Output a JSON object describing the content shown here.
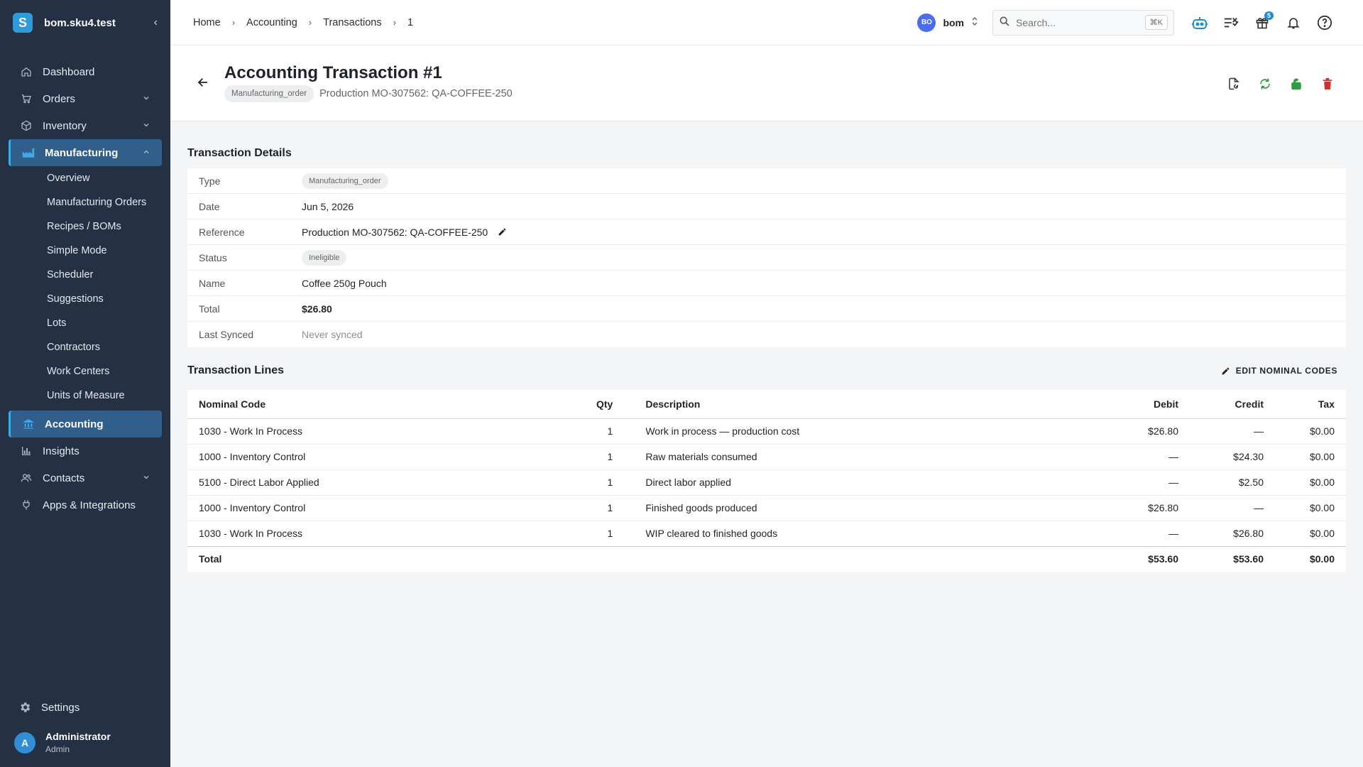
{
  "sidebar": {
    "brand_initial": "S",
    "brand_name": "bom.sku4.test",
    "collapse_glyph": "‹",
    "items": [
      {
        "label": "Dashboard",
        "icon": "home-icon"
      },
      {
        "label": "Orders",
        "icon": "cart-icon"
      },
      {
        "label": "Inventory",
        "icon": "box-icon"
      },
      {
        "label": "Manufacturing",
        "icon": "factory-icon"
      }
    ],
    "manufacturing_sub": [
      "Overview",
      "Manufacturing Orders",
      "Recipes / BOMs",
      "Simple Mode",
      "Scheduler",
      "Suggestions",
      "Lots",
      "Contractors",
      "Work Centers",
      "Units of Measure"
    ],
    "items_after": [
      {
        "label": "Accounting",
        "icon": "bank-icon"
      },
      {
        "label": "Insights",
        "icon": "chart-icon"
      },
      {
        "label": "Contacts",
        "icon": "people-icon"
      },
      {
        "label": "Apps & Integrations",
        "icon": "plug-icon"
      }
    ],
    "settings_label": "Settings",
    "user": {
      "initial": "A",
      "name": "Administrator",
      "role": "Admin"
    }
  },
  "topbar": {
    "breadcrumbs": [
      "Home",
      "Accounting",
      "Transactions",
      "1"
    ],
    "org_badge": "BO",
    "org_name": "bom",
    "search_placeholder": "Search...",
    "search_shortcut": "⌘K",
    "gift_count": "5"
  },
  "header": {
    "title": "Accounting Transaction #1",
    "type_chip": "Manufacturing_order",
    "reference": "Production MO-307562: QA-COFFEE-250"
  },
  "details": {
    "section_title": "Transaction Details",
    "rows": {
      "type": {
        "label": "Type",
        "value": "Manufacturing_order"
      },
      "date": {
        "label": "Date",
        "value": "Jun 5, 2026"
      },
      "reference": {
        "label": "Reference",
        "value": "Production MO-307562: QA-COFFEE-250"
      },
      "status": {
        "label": "Status",
        "value": "Ineligible"
      },
      "name": {
        "label": "Name",
        "value": "Coffee 250g Pouch"
      },
      "total": {
        "label": "Total",
        "value": "$26.80"
      },
      "last_synced": {
        "label": "Last Synced",
        "value": "Never synced"
      }
    }
  },
  "lines": {
    "section_title": "Transaction Lines",
    "edit_label": "EDIT NOMINAL CODES",
    "columns": {
      "code": "Nominal Code",
      "qty": "Qty",
      "desc": "Description",
      "debit": "Debit",
      "credit": "Credit",
      "tax": "Tax"
    },
    "rows": [
      {
        "code": "1030 - Work In Process",
        "qty": "1",
        "desc": "Work in process — production cost",
        "debit": "$26.80",
        "credit": "—",
        "tax": "$0.00"
      },
      {
        "code": "1000 - Inventory Control",
        "qty": "1",
        "desc": "Raw materials consumed",
        "debit": "—",
        "credit": "$24.30",
        "tax": "$0.00"
      },
      {
        "code": "5100 - Direct Labor Applied",
        "qty": "1",
        "desc": "Direct labor applied",
        "debit": "—",
        "credit": "$2.50",
        "tax": "$0.00"
      },
      {
        "code": "1000 - Inventory Control",
        "qty": "1",
        "desc": "Finished goods produced",
        "debit": "$26.80",
        "credit": "—",
        "tax": "$0.00"
      },
      {
        "code": "1030 - Work In Process",
        "qty": "1",
        "desc": "WIP cleared to finished goods",
        "debit": "—",
        "credit": "$26.80",
        "tax": "$0.00"
      }
    ],
    "total": {
      "label": "Total",
      "debit": "$53.60",
      "credit": "$53.60",
      "tax": "$0.00"
    }
  },
  "colors": {
    "sidebar_bg": "#243043",
    "accent": "#2e9bdc",
    "success": "#2e9d3f",
    "danger": "#d32f2f"
  }
}
